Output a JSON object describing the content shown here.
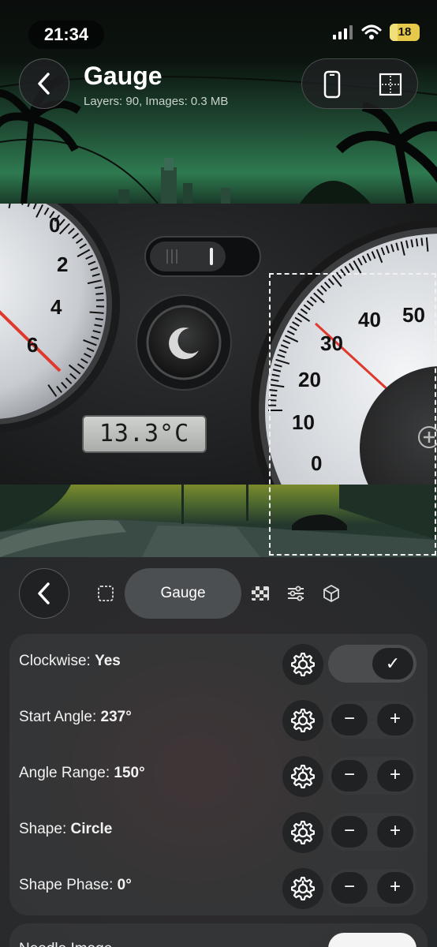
{
  "status_bar": {
    "time": "21:34",
    "battery": "18"
  },
  "header": {
    "back_icon": "chevron-left-icon",
    "title": "Gauge",
    "subtitle": "Layers: 90, Images: 0.3 MB",
    "device_icon": "phone-icon",
    "layout_icon": "grid-layout-icon"
  },
  "canvas": {
    "left_gauge_labels": [
      "0",
      "2",
      "4",
      "6"
    ],
    "right_gauge_labels": [
      "50",
      "40",
      "30",
      "20",
      "10",
      "0"
    ],
    "lcd_value": "13.3°C",
    "night_mode_icon": "moon-icon",
    "add_icon": "plus-circle-icon"
  },
  "toolbar": {
    "back_icon": "chevron-left-icon",
    "active_tab": "Gauge",
    "icons": [
      "selection-icon",
      "checkerboard-icon",
      "sliders-icon",
      "cube-icon"
    ]
  },
  "properties": [
    {
      "label": "Clockwise: ",
      "value": "Yes",
      "control": "toggle",
      "checked": true
    },
    {
      "label": "Start Angle: ",
      "value": "237°",
      "control": "stepper"
    },
    {
      "label": "Angle Range: ",
      "value": "150°",
      "control": "stepper"
    },
    {
      "label": "Shape: ",
      "value": "Circle",
      "control": "stepper"
    },
    {
      "label": "Shape Phase: ",
      "value": "0°",
      "control": "stepper"
    }
  ],
  "controls": {
    "minus": "−",
    "plus": "+",
    "check": "✓"
  },
  "next_row": {
    "label": "Needle Image"
  },
  "colors": {
    "needle": "#e0382c",
    "accent_green": "#2e7a50",
    "panel": "#2a2c2e"
  }
}
